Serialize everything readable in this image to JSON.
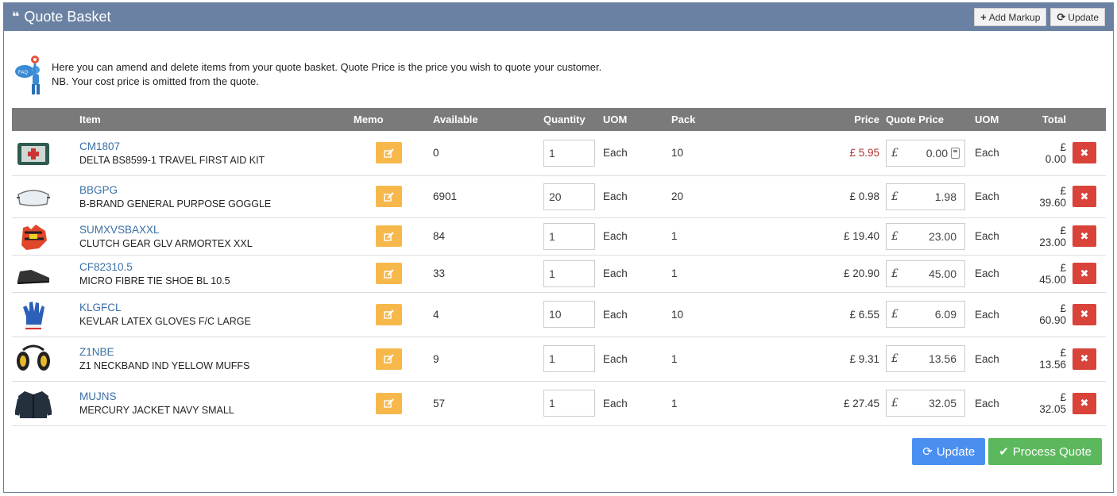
{
  "header": {
    "title": "Quote Basket",
    "add_markup_label": "Add Markup",
    "update_label": "Update"
  },
  "intro": {
    "line1": "Here you can amend and delete items from your quote basket. Quote Price is the price you wish to quote your customer.",
    "line2": "NB. Your cost price is omitted from the quote."
  },
  "columns": {
    "item": "Item",
    "memo": "Memo",
    "available": "Available",
    "quantity": "Quantity",
    "uom": "UOM",
    "pack": "Pack",
    "price": "Price",
    "quote_price": "Quote Price",
    "uom2": "UOM",
    "total": "Total"
  },
  "currency_symbol": "£",
  "rows": [
    {
      "code": "CM1807",
      "description": "DELTA BS8599-1 TRAVEL FIRST AID KIT",
      "available": "0",
      "quantity": "1",
      "uom": "Each",
      "pack": "10",
      "price": "£ 5.95",
      "quote_price": "0.00",
      "uom2": "Each",
      "total": "£ 0.00",
      "image": "first-aid-kit"
    },
    {
      "code": "BBGPG",
      "description": "B-BRAND GENERAL PURPOSE GOGGLE",
      "available": "6901",
      "quantity": "20",
      "uom": "Each",
      "pack": "20",
      "price": "£ 0.98",
      "quote_price": "1.98",
      "uom2": "Each",
      "total": "£ 39.60",
      "image": "goggle"
    },
    {
      "code": "SUMXVSBAXXL",
      "description": "CLUTCH GEAR GLV ARMORTEX XXL",
      "available": "84",
      "quantity": "1",
      "uom": "Each",
      "pack": "1",
      "price": "£ 19.40",
      "quote_price": "23.00",
      "uom2": "Each",
      "total": "£ 23.00",
      "image": "glove"
    },
    {
      "code": "CF82310.5",
      "description": "MICRO FIBRE TIE SHOE BL 10.5",
      "available": "33",
      "quantity": "1",
      "uom": "Each",
      "pack": "1",
      "price": "£ 20.90",
      "quote_price": "45.00",
      "uom2": "Each",
      "total": "£ 45.00",
      "image": "shoe"
    },
    {
      "code": "KLGFCL",
      "description": "KEVLAR LATEX GLOVES F/C LARGE",
      "available": "4",
      "quantity": "10",
      "uom": "Each",
      "pack": "10",
      "price": "£ 6.55",
      "quote_price": "6.09",
      "uom2": "Each",
      "total": "£ 60.90",
      "image": "latex-glove"
    },
    {
      "code": "Z1NBE",
      "description": "Z1 NECKBAND IND YELLOW MUFFS",
      "available": "9",
      "quantity": "1",
      "uom": "Each",
      "pack": "1",
      "price": "£ 9.31",
      "quote_price": "13.56",
      "uom2": "Each",
      "total": "£ 13.56",
      "image": "ear-muffs"
    },
    {
      "code": "MUJNS",
      "description": "MERCURY JACKET NAVY SMALL",
      "available": "57",
      "quantity": "1",
      "uom": "Each",
      "pack": "1",
      "price": "£ 27.45",
      "quote_price": "32.05",
      "uom2": "Each",
      "total": "£ 32.05",
      "image": "jacket"
    }
  ],
  "footer": {
    "update_label": "Update",
    "process_label": "Process Quote"
  },
  "colors": {
    "header_bg": "#6a81a3",
    "memo_button": "#f7b84b",
    "delete_button": "#d9433a",
    "update_button": "#4a8ff0",
    "process_button": "#5cb85c"
  }
}
